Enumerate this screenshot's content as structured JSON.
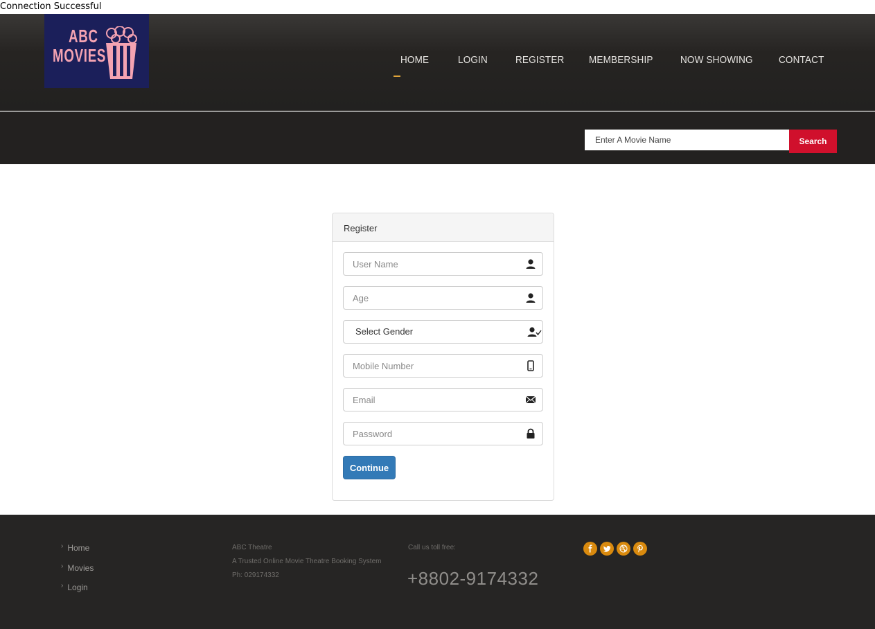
{
  "status_text": "Connection Successful",
  "logo": {
    "line1": "ABC",
    "line2": "MOVIES"
  },
  "nav": {
    "items": [
      "HOME",
      "LOGIN",
      "REGISTER",
      "MEMBERSHIP",
      "NOW SHOWING",
      "CONTACT"
    ],
    "active": "HOME"
  },
  "search": {
    "placeholder": "Enter A Movie Name",
    "button_label": "Search"
  },
  "register": {
    "title": "Register",
    "fields": {
      "username": {
        "placeholder": "User Name",
        "icon": "user-icon"
      },
      "age": {
        "placeholder": "Age",
        "icon": "user-icon"
      },
      "gender": {
        "value": "Select Gender",
        "icon": "user-check-icon"
      },
      "mobile": {
        "placeholder": "Mobile Number",
        "icon": "phone-icon"
      },
      "email": {
        "placeholder": "Email",
        "icon": "envelope-icon"
      },
      "password": {
        "placeholder": "Password",
        "icon": "lock-icon"
      }
    },
    "submit_label": "Continue"
  },
  "footer": {
    "links": [
      "Home",
      "Movies",
      "Login"
    ],
    "about": {
      "name": "ABC Theatre",
      "tagline": "A Trusted Online Movie Theatre Booking System",
      "phone_line": "Ph: 029174332"
    },
    "call_label": "Call us toll free:",
    "phone": "+8802-9174332",
    "social": [
      "facebook-icon",
      "twitter-icon",
      "dribbble-icon",
      "pinterest-icon"
    ]
  },
  "colors": {
    "accent": "#e0a43a",
    "search_button": "#d0102c",
    "primary_button": "#337ab7",
    "social": "#d98a0e",
    "logo_bg": "#1b1f5a",
    "logo_text": "#f4a3b2"
  }
}
